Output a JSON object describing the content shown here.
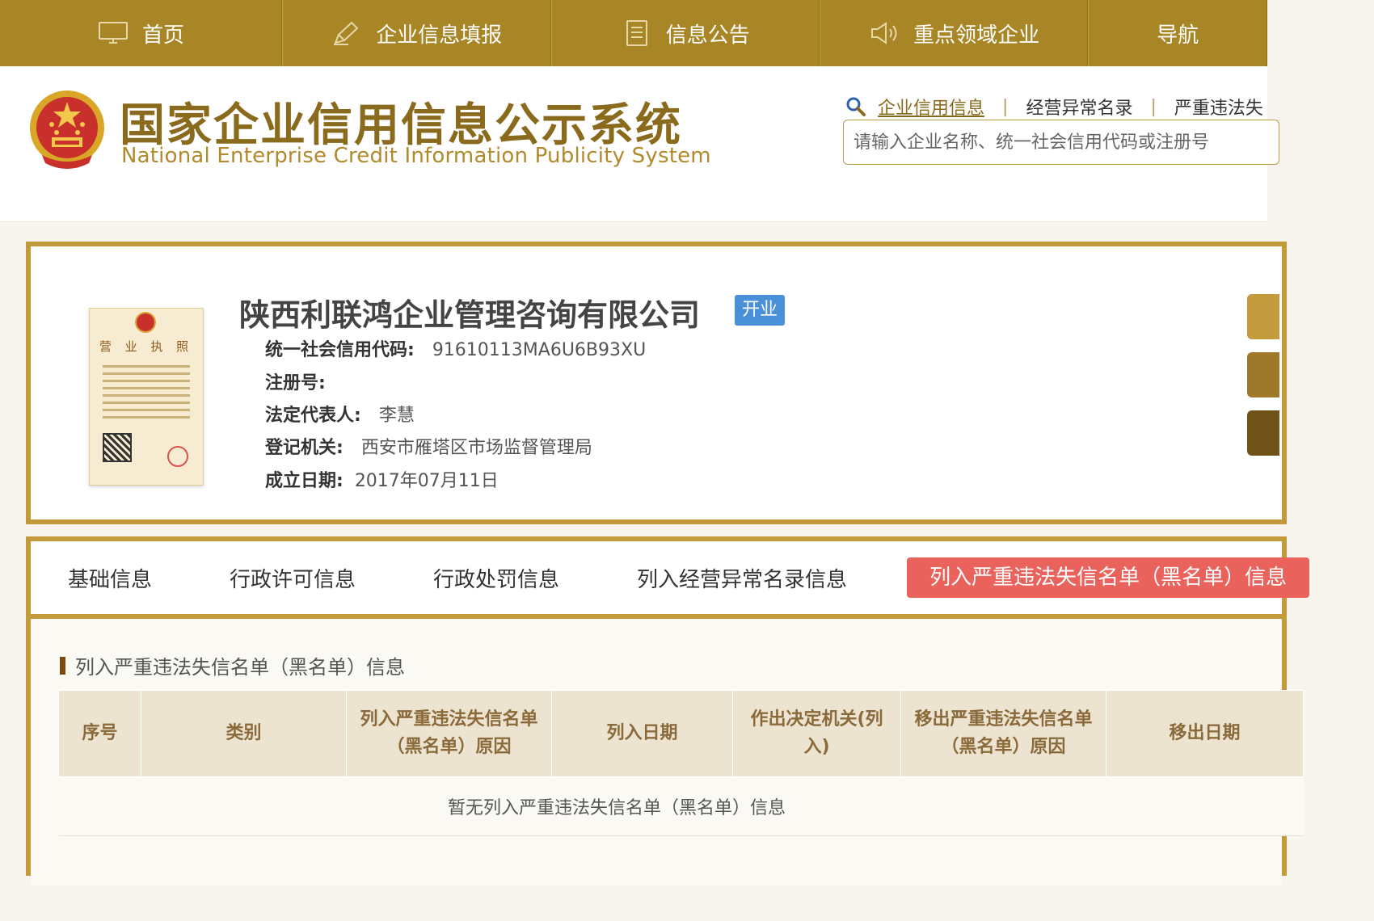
{
  "topnav": {
    "items": [
      {
        "label": "首页",
        "icon": "monitor-icon"
      },
      {
        "label": "企业信息填报",
        "icon": "pen-icon"
      },
      {
        "label": "信息公告",
        "icon": "document-icon"
      },
      {
        "label": "重点领域企业",
        "icon": "speaker-icon"
      },
      {
        "label": "导航",
        "icon": ""
      }
    ]
  },
  "header": {
    "title_cn": "国家企业信用信息公示系统",
    "title_en": "National Enterprise Credit Information Publicity System",
    "search_tabs": [
      "企业信用信息",
      "经营异常名录",
      "严重违法失"
    ],
    "search_placeholder": "请输入企业名称、统一社会信用代码或注册号"
  },
  "company": {
    "name": "陕西利联鸿企业管理咨询有限公司",
    "status": "开业",
    "license_title": "营 业 执 照",
    "fields": [
      {
        "label": "统一社会信用代码:",
        "value": "91610113MA6U6B93XU"
      },
      {
        "label": "注册号:",
        "value": ""
      },
      {
        "label": "法定代表人:",
        "value": "李慧"
      },
      {
        "label": "登记机关:",
        "value": "西安市雁塔区市场监督管理局"
      },
      {
        "label": "成立日期:",
        "value": "2017年07月11日"
      }
    ]
  },
  "tabs": [
    "基础信息",
    "行政许可信息",
    "行政处罚信息",
    "列入经营异常名录信息",
    "列入严重违法失信名单（黑名单）信息"
  ],
  "section": {
    "title": "列入严重违法失信名单（黑名单）信息",
    "columns": [
      "序号",
      "类别",
      "列入严重违法失信名单（黑名单）原因",
      "列入日期",
      "作出决定机关(列入)",
      "移出严重违法失信名单（黑名单）原因",
      "移出日期"
    ],
    "empty_text": "暂无列入严重违法失信名单（黑名单）信息"
  },
  "colors": {
    "nav_bg": "#a88625",
    "border_gold": "#c29a39",
    "active_tab": "#e9625c",
    "badge_blue": "#4a90d9"
  }
}
